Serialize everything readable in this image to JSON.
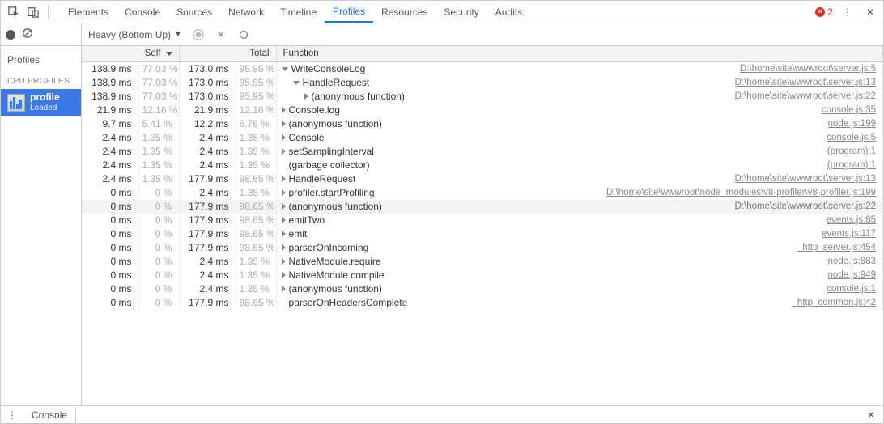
{
  "tabbar": {
    "tabs": [
      "Elements",
      "Console",
      "Sources",
      "Network",
      "Timeline",
      "Profiles",
      "Resources",
      "Security",
      "Audits"
    ],
    "active_index": 5,
    "error_count": "2"
  },
  "sidebar": {
    "heading_profiles": "Profiles",
    "heading_cpu": "CPU PROFILES",
    "profile": {
      "name": "profile",
      "status": "Loaded"
    }
  },
  "toolbar": {
    "view_mode": "Heavy (Bottom Up)"
  },
  "columns": {
    "self": "Self",
    "total": "Total",
    "function": "Function"
  },
  "rows": [
    {
      "self_ms": "138.9 ms",
      "self_pct": "77.03 %",
      "total_ms": "173.0 ms",
      "total_pct": "95.95 %",
      "indent": 0,
      "arrow": "down",
      "name": "WriteConsoleLog",
      "src": "D:\\home\\site\\wwwroot\\server.js:5"
    },
    {
      "self_ms": "138.9 ms",
      "self_pct": "77.03 %",
      "total_ms": "173.0 ms",
      "total_pct": "95.95 %",
      "indent": 1,
      "arrow": "down",
      "name": "HandleRequest",
      "src": "D:\\home\\site\\wwwroot\\server.js:13"
    },
    {
      "self_ms": "138.9 ms",
      "self_pct": "77.03 %",
      "total_ms": "173.0 ms",
      "total_pct": "95.95 %",
      "indent": 2,
      "arrow": "right",
      "name": "(anonymous function)",
      "src": "D:\\home\\site\\wwwroot\\server.js:22"
    },
    {
      "self_ms": "21.9 ms",
      "self_pct": "12.16 %",
      "total_ms": "21.9 ms",
      "total_pct": "12.16 %",
      "indent": 0,
      "arrow": "right",
      "name": "Console.log",
      "src": "console.js:35"
    },
    {
      "self_ms": "9.7 ms",
      "self_pct": "5.41 %",
      "total_ms": "12.2 ms",
      "total_pct": "6.76 %",
      "indent": 0,
      "arrow": "right",
      "name": "(anonymous function)",
      "src": "node.js:199"
    },
    {
      "self_ms": "2.4 ms",
      "self_pct": "1.35 %",
      "total_ms": "2.4 ms",
      "total_pct": "1.35 %",
      "indent": 0,
      "arrow": "right",
      "name": "Console",
      "src": "console.js:5"
    },
    {
      "self_ms": "2.4 ms",
      "self_pct": "1.35 %",
      "total_ms": "2.4 ms",
      "total_pct": "1.35 %",
      "indent": 0,
      "arrow": "right",
      "name": "setSamplingInterval",
      "src": "(program):1"
    },
    {
      "self_ms": "2.4 ms",
      "self_pct": "1.35 %",
      "total_ms": "2.4 ms",
      "total_pct": "1.35 %",
      "indent": 0,
      "arrow": "none",
      "name": "(garbage collector)",
      "src": "(program):1"
    },
    {
      "self_ms": "2.4 ms",
      "self_pct": "1.35 %",
      "total_ms": "177.9 ms",
      "total_pct": "98.65 %",
      "indent": 0,
      "arrow": "right",
      "name": "HandleRequest",
      "src": "D:\\home\\site\\wwwroot\\server.js:13"
    },
    {
      "self_ms": "0 ms",
      "self_pct": "0 %",
      "total_ms": "2.4 ms",
      "total_pct": "1.35 %",
      "indent": 0,
      "arrow": "right",
      "name": "profiler.startProfiling",
      "src": "D:\\home\\site\\wwwroot\\node_modules\\v8-profiler\\v8-profiler.js:199"
    },
    {
      "self_ms": "0 ms",
      "self_pct": "0 %",
      "total_ms": "177.9 ms",
      "total_pct": "98.65 %",
      "indent": 0,
      "arrow": "right",
      "name": "(anonymous function)",
      "src": "D:\\home\\site\\wwwroot\\server.js:22",
      "highlight": true
    },
    {
      "self_ms": "0 ms",
      "self_pct": "0 %",
      "total_ms": "177.9 ms",
      "total_pct": "98.65 %",
      "indent": 0,
      "arrow": "right",
      "name": "emitTwo",
      "src": "events.js:85"
    },
    {
      "self_ms": "0 ms",
      "self_pct": "0 %",
      "total_ms": "177.9 ms",
      "total_pct": "98.65 %",
      "indent": 0,
      "arrow": "right",
      "name": "emit",
      "src": "events.js:117"
    },
    {
      "self_ms": "0 ms",
      "self_pct": "0 %",
      "total_ms": "177.9 ms",
      "total_pct": "98.65 %",
      "indent": 0,
      "arrow": "right",
      "name": "parserOnIncoming",
      "src": "_http_server.js:454"
    },
    {
      "self_ms": "0 ms",
      "self_pct": "0 %",
      "total_ms": "2.4 ms",
      "total_pct": "1.35 %",
      "indent": 0,
      "arrow": "right",
      "name": "NativeModule.require",
      "src": "node.js:883"
    },
    {
      "self_ms": "0 ms",
      "self_pct": "0 %",
      "total_ms": "2.4 ms",
      "total_pct": "1.35 %",
      "indent": 0,
      "arrow": "right",
      "name": "NativeModule.compile",
      "src": "node.js:949"
    },
    {
      "self_ms": "0 ms",
      "self_pct": "0 %",
      "total_ms": "2.4 ms",
      "total_pct": "1.35 %",
      "indent": 0,
      "arrow": "right",
      "name": "(anonymous function)",
      "src": "console.js:1"
    },
    {
      "self_ms": "0 ms",
      "self_pct": "0 %",
      "total_ms": "177.9 ms",
      "total_pct": "98.65 %",
      "indent": 0,
      "arrow": "none",
      "name": "parserOnHeadersComplete",
      "src": "_http_common.js:42"
    }
  ],
  "drawer": {
    "tab": "Console"
  }
}
